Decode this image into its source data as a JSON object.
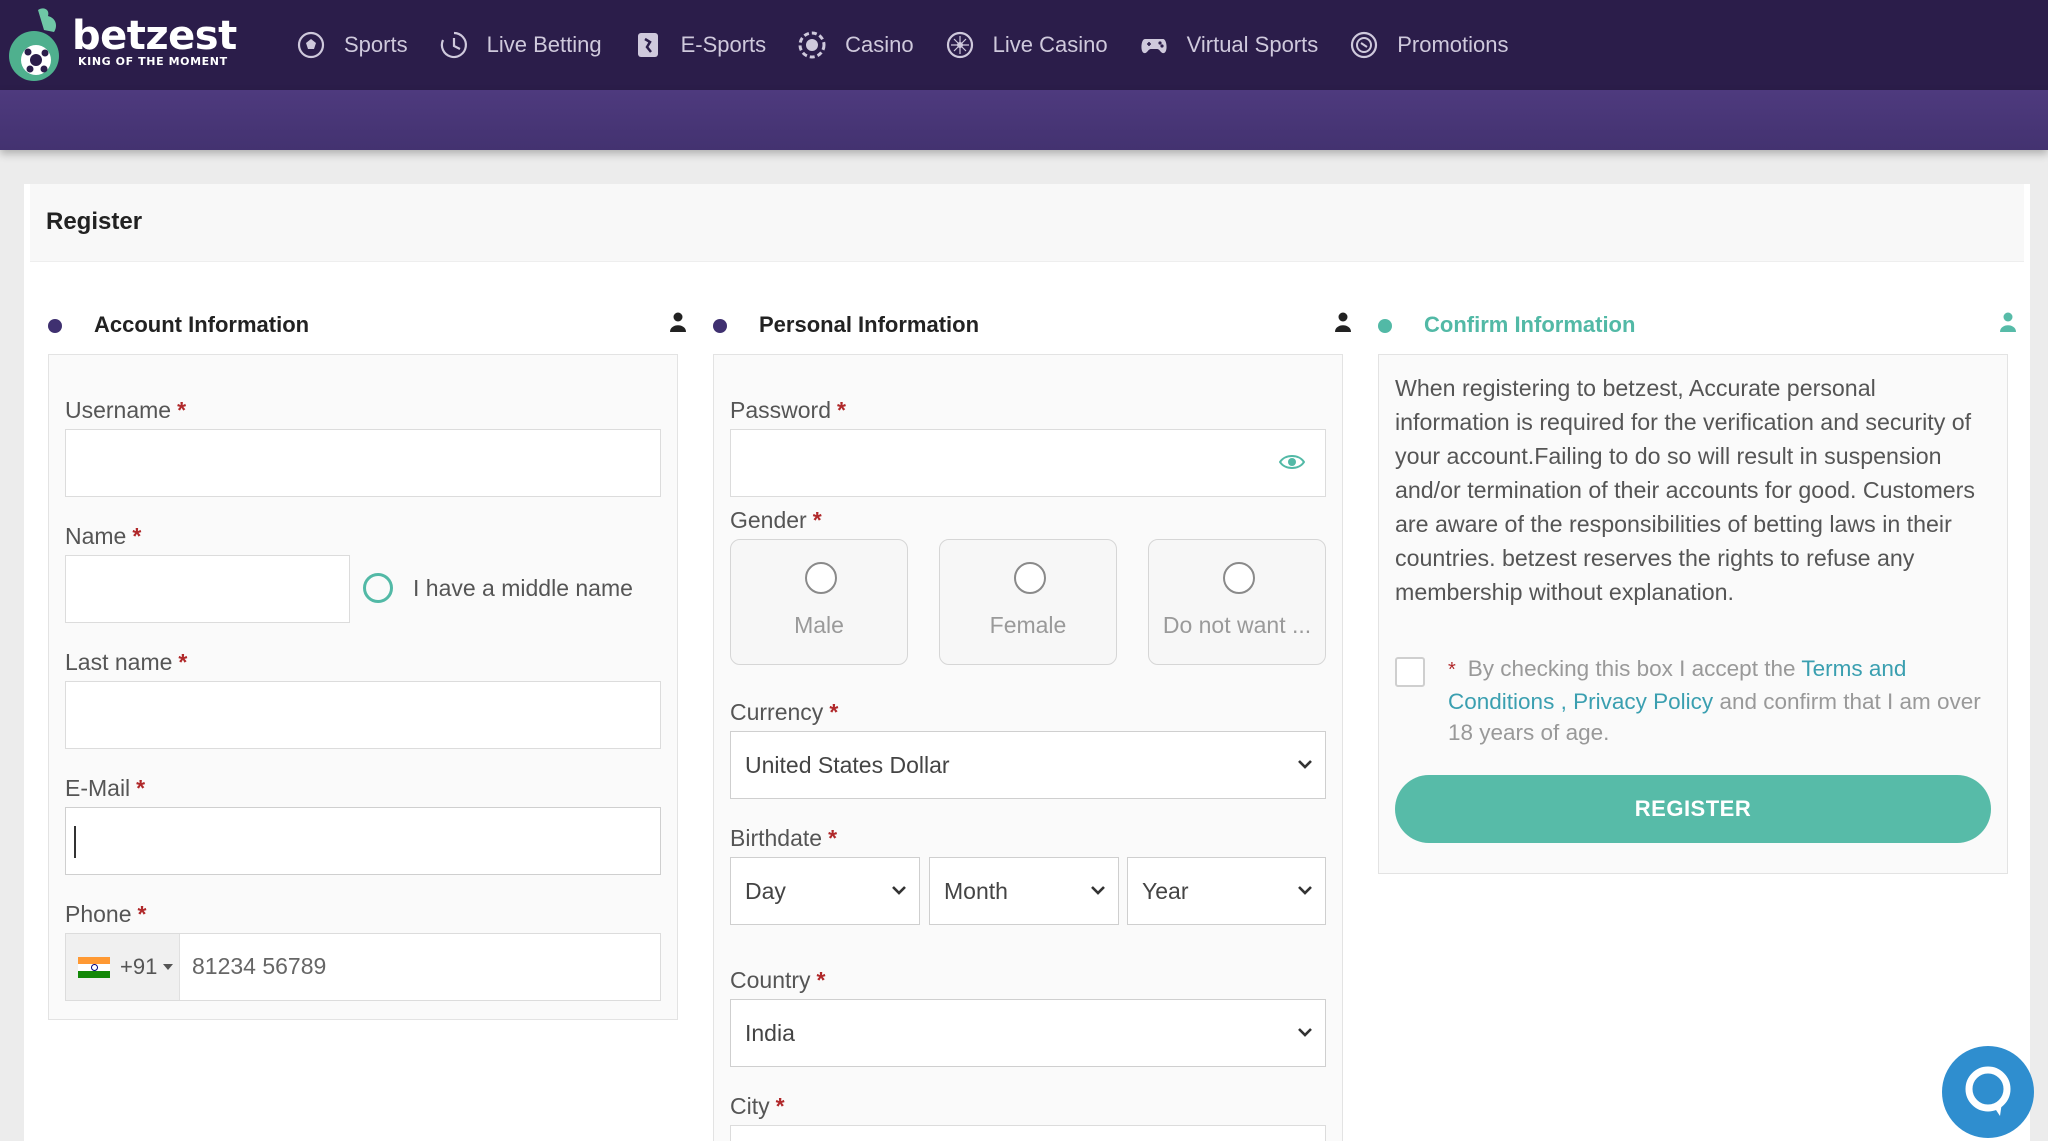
{
  "brand": {
    "name": "betzest",
    "tagline": "KING OF THE MOMENT"
  },
  "nav": [
    {
      "label": "Sports",
      "icon": "soccer-ball-icon"
    },
    {
      "label": "Live Betting",
      "icon": "clock-icon"
    },
    {
      "label": "E-Sports",
      "icon": "esports-icon"
    },
    {
      "label": "Casino",
      "icon": "casino-chip-icon"
    },
    {
      "label": "Live Casino",
      "icon": "roulette-icon"
    },
    {
      "label": "Virtual Sports",
      "icon": "gamepad-icon"
    },
    {
      "label": "Promotions",
      "icon": "promo-icon"
    }
  ],
  "page": {
    "title": "Register"
  },
  "sections": {
    "account": {
      "title": "Account Information",
      "username_label": "Username",
      "name_label": "Name",
      "middle_name_label": "I have a middle name",
      "lastname_label": "Last name",
      "email_label": "E-Mail",
      "phone_label": "Phone",
      "phone_code": "+91",
      "phone_placeholder": "81234 56789"
    },
    "personal": {
      "title": "Personal Information",
      "password_label": "Password",
      "gender_label": "Gender",
      "gender_options": [
        "Male",
        "Female",
        "Do not want ..."
      ],
      "currency_label": "Currency",
      "currency_value": "United States Dollar",
      "birthdate_label": "Birthdate",
      "day": "Day",
      "month": "Month",
      "year": "Year",
      "country_label": "Country",
      "country_value": "India",
      "city_label": "City"
    },
    "confirm": {
      "title": "Confirm Information",
      "text": "When registering to betzest, Accurate personal information is required for the verification and security of your account.Failing to do so will result in suspension and/or termination of their accounts for good. Customers are aware of the responsibilities of betting laws in their countries. betzest reserves the rights to refuse any membership without explanation.",
      "terms_prefix": "By checking this box I accept the",
      "terms_link": "Terms and Conditions",
      "terms_sep": ",",
      "privacy_link": "Privacy Policy",
      "terms_suffix": "and confirm that I am over 18 years of age.",
      "register_button": "REGISTER"
    }
  },
  "colors": {
    "header": "#2b1d4a",
    "subbar": "#4a3778",
    "accent_teal": "#57bba8",
    "required": "#b0282a",
    "link": "#3a9fb0"
  }
}
